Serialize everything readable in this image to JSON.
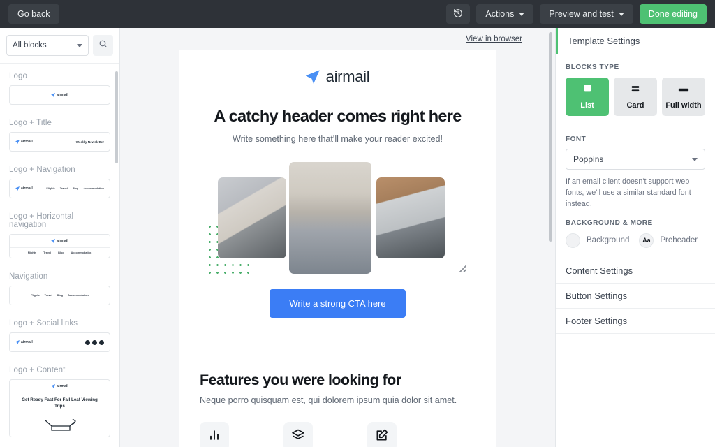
{
  "topbar": {
    "go_back": "Go back",
    "history_icon": "history-revert-icon",
    "actions": "Actions",
    "preview_and_test": "Preview and test",
    "done_editing": "Done editing",
    "accent_green": "#4ec173",
    "bar_background": "#2e3238"
  },
  "sidebar": {
    "filter_value": "All blocks",
    "search_icon": "search-icon",
    "groups": [
      {
        "label": "Logo",
        "brand": "airmail"
      },
      {
        "label": "Logo + Title",
        "brand": "airmail",
        "title": "Weekly Newsletter"
      },
      {
        "label": "Logo + Navigation",
        "brand": "airmail",
        "nav": [
          "Flights",
          "Travel",
          "Blog",
          "Accommodation"
        ]
      },
      {
        "label": "Logo + Horizontal navigation",
        "brand": "airmail",
        "nav": [
          "Flights",
          "Travel",
          "Blog",
          "Accommodation"
        ]
      },
      {
        "label": "Navigation",
        "nav": [
          "Flights",
          "Travel",
          "Blog",
          "Accommodation"
        ]
      },
      {
        "label": "Logo + Social links",
        "brand": "airmail"
      },
      {
        "label": "Logo + Content",
        "brand": "airmail",
        "title": "Get Ready Fast For Fall Leaf Viewing Trips"
      }
    ]
  },
  "email": {
    "view_in_browser": "View in browser",
    "brand": "airmail",
    "headline": "A catchy header comes right here",
    "subline": "Write something here that'll make your reader excited!",
    "cta": "Write a strong CTA here",
    "features_title": "Features you were looking for",
    "features_sub": "Neque porro quisquam est, qui dolorem ipsum quia dolor sit amet.",
    "feature_icons": [
      "bar-chart-icon",
      "layers-icon",
      "edit-square-icon"
    ],
    "cta_color": "#3b7df5",
    "dots_color": "#4caf6d"
  },
  "settings": {
    "panel_title": "Template Settings",
    "blocks_type_label": "BLOCKS TYPE",
    "blocks_types": [
      {
        "label": "List",
        "icon": "square-icon",
        "selected": true
      },
      {
        "label": "Card",
        "icon": "rows-icon",
        "selected": false
      },
      {
        "label": "Full width",
        "icon": "bar-icon",
        "selected": false
      }
    ],
    "font_label": "FONT",
    "font_value": "Poppins",
    "font_note": "If an email client doesn't support web fonts, we'll use a similar standard font instead.",
    "background_label": "BACKGROUND & MORE",
    "background_swatch": "Background",
    "preheader_icon": "Aa",
    "preheader": "Preheader",
    "sections": [
      "Content Settings",
      "Button Settings",
      "Footer Settings"
    ],
    "selected_color": "#4ec173"
  }
}
